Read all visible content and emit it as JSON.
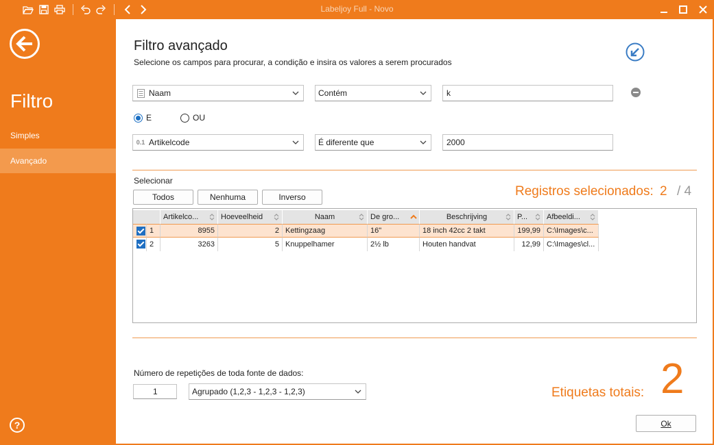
{
  "titlebar": {
    "title": "Labeljoy Full - Novo",
    "icons": [
      "open-folder-icon",
      "save-icon",
      "print-icon",
      "undo-icon",
      "redo-icon",
      "nav-back-icon",
      "nav-forward-icon"
    ]
  },
  "sidebar": {
    "title": "Filtro",
    "items": [
      {
        "label": "Simples",
        "active": false
      },
      {
        "label": "Avançado",
        "active": true
      }
    ]
  },
  "header": {
    "title": "Filtro avançado",
    "subtitle": "Selecione os campos para procurar, a condição e insira os valores a serem procurados"
  },
  "conditions": [
    {
      "field": "Naam",
      "operator": "Contém",
      "value": "k"
    },
    {
      "field": "Artikelcode",
      "field_type_badge": "0.1",
      "operator": "É diferente que",
      "value": "2000"
    }
  ],
  "logic": {
    "and_label": "E",
    "or_label": "OU",
    "selected": "E"
  },
  "selection": {
    "label": "Selecionar",
    "buttons": {
      "all": "Todos",
      "none": "Nenhuma",
      "inverse": "Inverso"
    },
    "selected_label": "Registros selecionados:",
    "selected_count": "2",
    "total": "/ 4"
  },
  "grid": {
    "columns": [
      "Artikelco...",
      "Hoeveelheid",
      "Naam",
      "De gro...",
      "Beschrijving",
      "P...",
      "Afbeeldi..."
    ],
    "rows": [
      {
        "index": "1",
        "checked": true,
        "cells": [
          "8955",
          "2",
          "Kettingzaag",
          "16\"",
          "18 inch 42cc 2 takt",
          "199,99",
          "C:\\Images\\c..."
        ]
      },
      {
        "index": "2",
        "checked": true,
        "cells": [
          "3263",
          "5",
          "Knuppelhamer",
          "2½ lb",
          "Houten handvat",
          "12,99",
          "C:\\Images\\cl..."
        ]
      }
    ]
  },
  "repetitions": {
    "label": "Número de repetições de toda fonte de dados:",
    "value": "1",
    "mode": "Agrupado (1,2,3 - 1,2,3 - 1,2,3)"
  },
  "totals": {
    "label": "Etiquetas totais:",
    "value": "2"
  },
  "ok_label": "Ok",
  "colors": {
    "accent": "#ef7b1c",
    "selected_row": "#fde3cf",
    "checkbox": "#1f6fc2"
  }
}
